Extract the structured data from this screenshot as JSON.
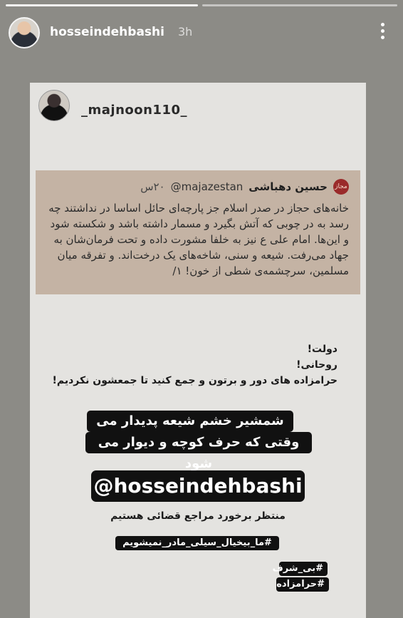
{
  "story": {
    "username": "hosseindehbashi",
    "time_ago": "3h",
    "progress_segments": [
      1,
      0
    ]
  },
  "repost": {
    "username": "_majnoon110_"
  },
  "tweet": {
    "name": "حسین دهباشی",
    "handle": "@majazestan",
    "time": "۲۰س",
    "logo_text": "مجاز",
    "body": "خانه‌های حجاز در صدر اسلام جز پارچه‌ای حائل اساسا در نداشتند چه رسد به در چوبی که آتش بگیرد و مسمار داشته باشد و شکسته شود و این‌ها. امام علی ع نیز به خلفا مشورت داده و تحت فرمان‌شان به جهاد می‌رفت. شیعه و سنی، شاخه‌های یک درخت‌اند. و تفرقه میان مسلمین، سرچشمه‌ی شطی از خون! ۱/"
  },
  "caption": {
    "line1": "دولت!",
    "line2": "روحانی!",
    "line3": "حرامزاده های دور و برتون و جمع کنید تا جمعشون نکردیم!",
    "sword_line1": "شمشیر خشم شیعه پدیدار می شود",
    "sword_line2": "وقتی که حرف کوچه و دیوار می شود",
    "mention": "@hosseindehbashi",
    "awaiting": "منتظر برخورد مراجع قضائی هستیم",
    "hashtag1": "#ما_بیخیال_سیلی_مادر_نمیشویم",
    "hashtag2": "#بی_شرف",
    "hashtag3": "#حرامزاده"
  },
  "icons": {
    "more": "more-vertical-icon"
  }
}
